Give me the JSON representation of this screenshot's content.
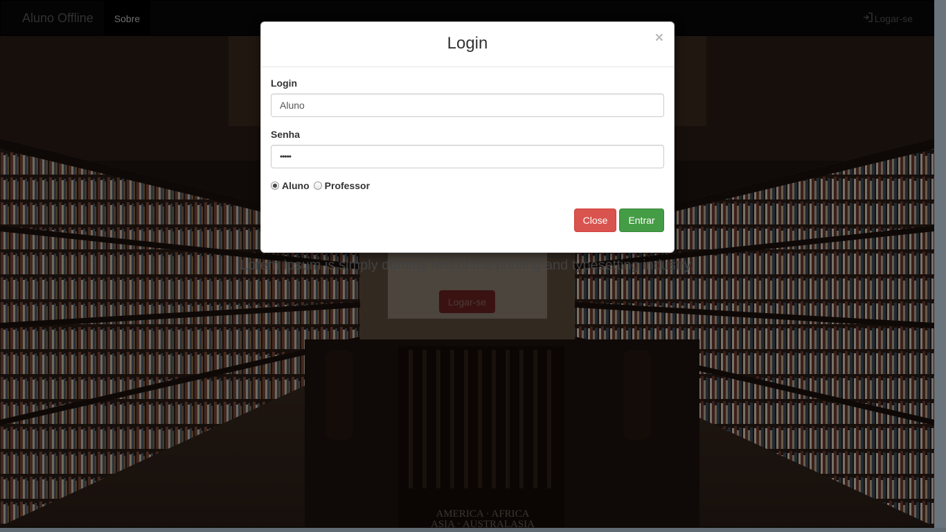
{
  "navbar": {
    "brand": "Aluno Offline",
    "active_item": "Sobre",
    "login_link": "Logar-se",
    "login_icon": "sign-in-icon"
  },
  "hero": {
    "text": "Lorem Ipsum is simply dummy text of the printing and typesetting industry.",
    "button_label": "Logar-se"
  },
  "background": {
    "sign_line1": "AMERICA · AFRICA",
    "sign_line2": "ASIA · AUSTRALASIA"
  },
  "modal": {
    "title": "Login",
    "close_glyph": "×",
    "login_label": "Login",
    "login_value": "Aluno",
    "password_label": "Senha",
    "password_value": "•••••",
    "radio_options": [
      "Aluno",
      "Professor"
    ],
    "radio_selected": "Aluno",
    "close_button": "Close",
    "submit_button": "Entrar"
  },
  "colors": {
    "danger": "#d9534f",
    "success": "#449d44",
    "navbar": "#080808"
  }
}
